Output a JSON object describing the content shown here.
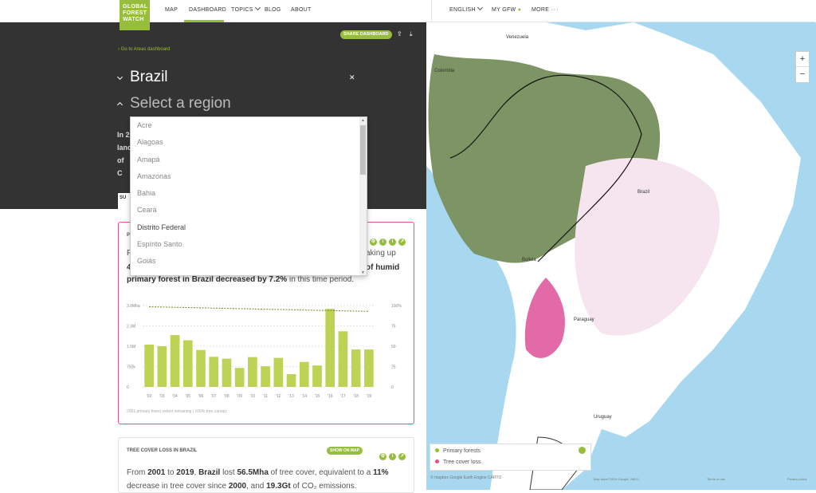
{
  "brand": {
    "logo_lines": [
      "GLOBAL",
      "FOREST",
      "WATCH"
    ],
    "accent": "#97bd3d",
    "pink": "#e3508b"
  },
  "nav": {
    "items": [
      "MAP",
      "DASHBOARD",
      "TOPICS",
      "BLOG",
      "ABOUT"
    ],
    "active": "DASHBOARD",
    "right": {
      "language": "ENGLISH",
      "mygfw": "MY GFW",
      "more": "MORE"
    }
  },
  "header": {
    "share_label": "SHARE DASHBOARD",
    "share_icon": "share-icon",
    "download_icon": "download-icon",
    "go_to_label": "Go to Areas dashboard",
    "country": "Brazil",
    "region_placeholder": "Select a region",
    "intro_fragment": [
      "In 2",
      "land",
      "of C"
    ],
    "tab_fragment": "SU"
  },
  "dropdown": {
    "options": [
      "Acre",
      "Alagoas",
      "Amapá",
      "Amazonas",
      "Bahia",
      "Ceará",
      "Distrito Federal",
      "Espírito Santo",
      "Goiás"
    ],
    "highlighted": "Distrito Federal"
  },
  "card1": {
    "title_fragment": "P",
    "text_frag_left": "F",
    "text_frag_left2": "4",
    "text_frag_right1": "aking up",
    "text_frag_right2": "of humid",
    "line3_bold": "primary forest in Brazil decreased by 7.2%",
    "line3_rest": " in this time period.",
    "caption": "2001 primary forest extent remaining | 100% tree canopy",
    "icons": [
      "gear-icon",
      "info-icon",
      "info-icon",
      "share-icon"
    ]
  },
  "chart_data": {
    "type": "bar",
    "categories": [
      "'02",
      "'03",
      "'04",
      "'05",
      "'06",
      "'07",
      "'08",
      "'09",
      "'10",
      "'11",
      "'12",
      "'13",
      "'14",
      "'15",
      "'16",
      "'17",
      "'18",
      "'19"
    ],
    "values": [
      1.56,
      1.5,
      1.91,
      1.72,
      1.36,
      1.11,
      1.04,
      0.7,
      1.1,
      0.76,
      1.07,
      0.47,
      0.92,
      0.79,
      2.88,
      2.05,
      1.38,
      1.38
    ],
    "y_ticks": [
      "0",
      "750k",
      "1.5M",
      "2.3M",
      "3.0Mha"
    ],
    "ylim": [
      0,
      3.0
    ],
    "y2_ticks": [
      "0",
      "25",
      "50",
      "75",
      "100%"
    ],
    "line_start": 98.5,
    "line_end": 92.8,
    "bar_color": "#bcd356",
    "line_color": "#6e8b2a"
  },
  "card2": {
    "title": "TREE COVER LOSS IN BRAZIL",
    "show_on_map": "SHOW ON MAP",
    "text": {
      "s1": "From ",
      "b1": "2001",
      "s2": " to ",
      "b2": "2019",
      "s3": ", ",
      "b3": "Brazil",
      "s4": " lost ",
      "b4": "56.5Mha",
      "s5": " of tree cover, equivalent to a ",
      "b5": "11%",
      "s6": " decrease in tree cover since ",
      "b6": "2000",
      "s7": ", and ",
      "b7": "19.3Gt",
      "s8": " of CO₂ emissions."
    }
  },
  "map": {
    "zoom_in": "+",
    "zoom_out": "−",
    "labels": [
      "Venezuela",
      "Colombia",
      "Brazil",
      "Bolivia",
      "Paraguay",
      "Uruguay"
    ],
    "legend": {
      "items": [
        {
          "label": "Primary forests",
          "color": "#97bd3d"
        },
        {
          "label": "Tree cover loss",
          "color": "#e3508b"
        }
      ]
    },
    "attribution_left": "© mapbox  Google Earth Engine  CARTO",
    "attribution_mid": "Map data ©2019 Google, INEGI",
    "attribution_terms": "Terms of use",
    "attribution_privacy": "Privacy policy"
  }
}
